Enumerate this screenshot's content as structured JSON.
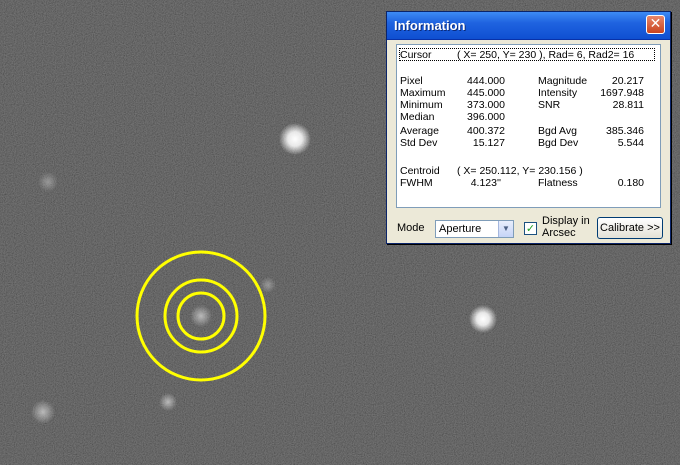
{
  "window": {
    "title": "Information",
    "close_label": "✕"
  },
  "info": {
    "cursor_label": "Cursor",
    "cursor_value": "( X=  250, Y=  230 ), Rad=  6, Rad2= 16",
    "stats": [
      {
        "label": "Pixel",
        "value": "444.000",
        "label2": "Magnitude",
        "value2": "20.217"
      },
      {
        "label": "Maximum",
        "value": "445.000",
        "label2": "Intensity",
        "value2": "1697.948"
      },
      {
        "label": "Minimum",
        "value": "373.000",
        "label2": "SNR",
        "value2": "28.811"
      },
      {
        "label": "Median",
        "value": "396.000",
        "label2": "",
        "value2": ""
      },
      {
        "label": "Average",
        "value": "400.372",
        "label2": "Bgd Avg",
        "value2": "385.346"
      },
      {
        "label": "Std Dev",
        "value": "15.127",
        "label2": "Bgd Dev",
        "value2": "5.544"
      }
    ],
    "centroid_label": "Centroid",
    "centroid_value": "( X=  250.112, Y=  230.156 )",
    "fwhm_label": "FWHM",
    "fwhm_value": "4.123''",
    "flatness_label": "Flatness",
    "flatness_value": "0.180"
  },
  "controls": {
    "mode_label": "Mode",
    "mode_selected": "Aperture",
    "display_arcsec_line1": "Display in",
    "display_arcsec_line2": "Arcsec",
    "display_arcsec_checked": true,
    "calibrate_label": "Calibrate >>"
  },
  "aperture_color": "#ffff00"
}
